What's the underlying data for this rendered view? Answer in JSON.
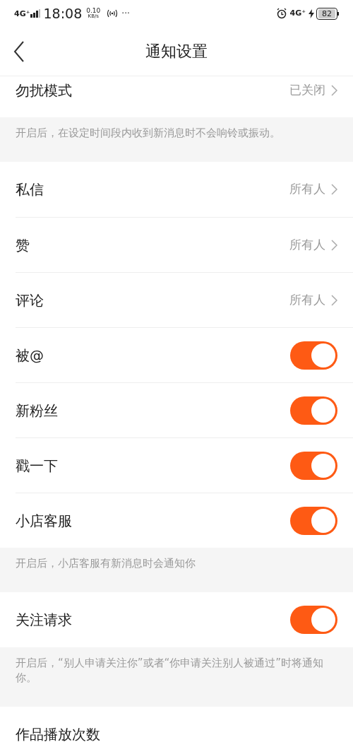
{
  "status_bar": {
    "network_left": "4G⁺",
    "time": "18:08",
    "speed": "0.10",
    "speed_unit": "KB/s",
    "more": "···",
    "network_right": "4G⁺",
    "battery": "82"
  },
  "header": {
    "title": "通知设置"
  },
  "items": [
    {
      "kind": "value",
      "label": "勿扰模式",
      "value": "已关闭"
    },
    {
      "kind": "note",
      "text": "开启后，在设定时间段内收到新消息时不会响铃或振动。"
    },
    {
      "kind": "value",
      "label": "私信",
      "value": "所有人"
    },
    {
      "kind": "value",
      "label": "赞",
      "value": "所有人"
    },
    {
      "kind": "value",
      "label": "评论",
      "value": "所有人"
    },
    {
      "kind": "toggle",
      "label": "被@",
      "on": true
    },
    {
      "kind": "toggle",
      "label": "新粉丝",
      "on": true
    },
    {
      "kind": "toggle",
      "label": "戳一下",
      "on": true
    },
    {
      "kind": "toggle",
      "label": "小店客服",
      "on": true
    },
    {
      "kind": "note",
      "text": "开启后，小店客服有新消息时会通知你"
    },
    {
      "kind": "toggle",
      "label": "关注请求",
      "on": true
    },
    {
      "kind": "note",
      "text": "开启后，“别人申请关注你”或者“你申请关注别人被通过”时将通知你。"
    },
    {
      "kind": "plain",
      "label": "作品播放次数"
    }
  ]
}
